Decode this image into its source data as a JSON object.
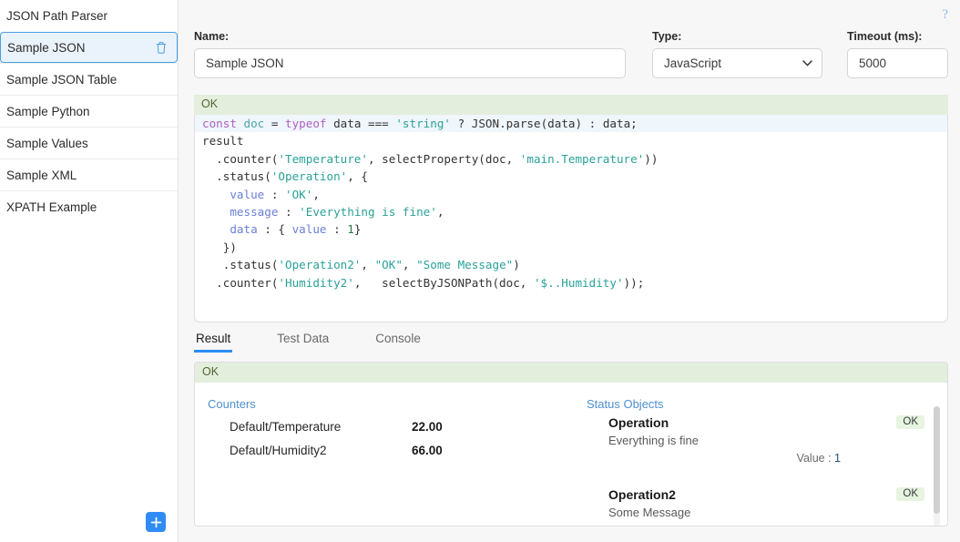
{
  "sidebar": {
    "items": [
      {
        "label": "JSON Path Parser",
        "selected": false,
        "deletable": false
      },
      {
        "label": "Sample JSON",
        "selected": true,
        "deletable": true
      },
      {
        "label": "Sample JSON Table",
        "selected": false,
        "deletable": false
      },
      {
        "label": "Sample Python",
        "selected": false,
        "deletable": false
      },
      {
        "label": "Sample Values",
        "selected": false,
        "deletable": false
      },
      {
        "label": "Sample XML",
        "selected": false,
        "deletable": false
      },
      {
        "label": "XPATH Example",
        "selected": false,
        "deletable": false
      }
    ],
    "add_button": {
      "icon": "plus-icon",
      "label": "+"
    },
    "delete_icon": "trash-icon"
  },
  "help": {
    "icon": "question-mark-icon",
    "label": "?"
  },
  "form": {
    "name": {
      "label": "Name:",
      "value": "Sample JSON",
      "placeholder": ""
    },
    "type": {
      "label": "Type:",
      "value": "JavaScript",
      "options": [
        "JavaScript"
      ],
      "caret_icon": "chevron-down-icon"
    },
    "timeout": {
      "label": "Timeout (ms):",
      "value": "5000",
      "placeholder": ""
    }
  },
  "editor": {
    "status": "OK",
    "lines": [
      {
        "active": true,
        "tokens": [
          {
            "t": "const ",
            "c": "kw"
          },
          {
            "t": "doc ",
            "c": "id"
          },
          {
            "t": "= ",
            "c": "pl"
          },
          {
            "t": "typeof ",
            "c": "kw"
          },
          {
            "t": "data === ",
            "c": "pl"
          },
          {
            "t": "'string'",
            "c": "str"
          },
          {
            "t": " ? JSON.parse(data) : data;",
            "c": "pl"
          }
        ]
      },
      {
        "active": false,
        "tokens": [
          {
            "t": "result",
            "c": "pl"
          }
        ]
      },
      {
        "active": false,
        "tokens": [
          {
            "t": "  .counter(",
            "c": "pl"
          },
          {
            "t": "'Temperature'",
            "c": "str"
          },
          {
            "t": ", selectProperty(doc, ",
            "c": "pl"
          },
          {
            "t": "'main.Temperature'",
            "c": "str"
          },
          {
            "t": "))",
            "c": "pl"
          }
        ]
      },
      {
        "active": false,
        "tokens": [
          {
            "t": "  .status(",
            "c": "pl"
          },
          {
            "t": "'Operation'",
            "c": "str"
          },
          {
            "t": ", {",
            "c": "pl"
          }
        ]
      },
      {
        "active": false,
        "tokens": [
          {
            "t": "    value ",
            "c": "prop"
          },
          {
            "t": ": ",
            "c": "pl"
          },
          {
            "t": "'OK'",
            "c": "str"
          },
          {
            "t": ",",
            "c": "pl"
          }
        ]
      },
      {
        "active": false,
        "tokens": [
          {
            "t": "    message ",
            "c": "prop"
          },
          {
            "t": ": ",
            "c": "pl"
          },
          {
            "t": "'Everything is fine'",
            "c": "str"
          },
          {
            "t": ",",
            "c": "pl"
          }
        ]
      },
      {
        "active": false,
        "tokens": [
          {
            "t": "    data ",
            "c": "prop"
          },
          {
            "t": ": { ",
            "c": "pl"
          },
          {
            "t": "value ",
            "c": "prop"
          },
          {
            "t": ": ",
            "c": "pl"
          },
          {
            "t": "1",
            "c": "num"
          },
          {
            "t": "}",
            "c": "pl"
          }
        ]
      },
      {
        "active": false,
        "tokens": [
          {
            "t": "   })",
            "c": "pl"
          }
        ]
      },
      {
        "active": false,
        "tokens": [
          {
            "t": "   .status(",
            "c": "pl"
          },
          {
            "t": "'Operation2'",
            "c": "str"
          },
          {
            "t": ", ",
            "c": "pl"
          },
          {
            "t": "\"OK\"",
            "c": "str"
          },
          {
            "t": ", ",
            "c": "pl"
          },
          {
            "t": "\"Some Message\"",
            "c": "str"
          },
          {
            "t": ")",
            "c": "pl"
          }
        ]
      },
      {
        "active": false,
        "tokens": [
          {
            "t": "  .counter(",
            "c": "pl"
          },
          {
            "t": "'Humidity2'",
            "c": "str"
          },
          {
            "t": ",   selectByJSONPath(doc, ",
            "c": "pl"
          },
          {
            "t": "'$..Humidity'",
            "c": "str"
          },
          {
            "t": "));",
            "c": "pl"
          }
        ]
      }
    ]
  },
  "tabs": [
    {
      "label": "Result",
      "active": true
    },
    {
      "label": "Test Data",
      "active": false
    },
    {
      "label": "Console",
      "active": false
    }
  ],
  "result": {
    "status": "OK",
    "counters": {
      "title": "Counters",
      "rows": [
        {
          "name": "Default/Temperature",
          "value": "22.00"
        },
        {
          "name": "Default/Humidity2",
          "value": "66.00"
        }
      ]
    },
    "status_objects": {
      "title": "Status Objects",
      "items": [
        {
          "name": "Operation",
          "message": "Everything is fine",
          "kv_label": "Value :",
          "kv_value": "1",
          "badge": "OK"
        },
        {
          "name": "Operation2",
          "message": "Some Message",
          "kv_label": "",
          "kv_value": "",
          "badge": "OK"
        }
      ]
    }
  },
  "colors": {
    "accent": "#2f8cf5",
    "ok_bg": "#e3eedd",
    "ok_text": "#55652f",
    "badge_bg": "#e6f4e0",
    "section_title": "#4e8fd1",
    "selected_item_bg": "#eaf3fb",
    "selected_item_border": "#4a9fe0"
  }
}
